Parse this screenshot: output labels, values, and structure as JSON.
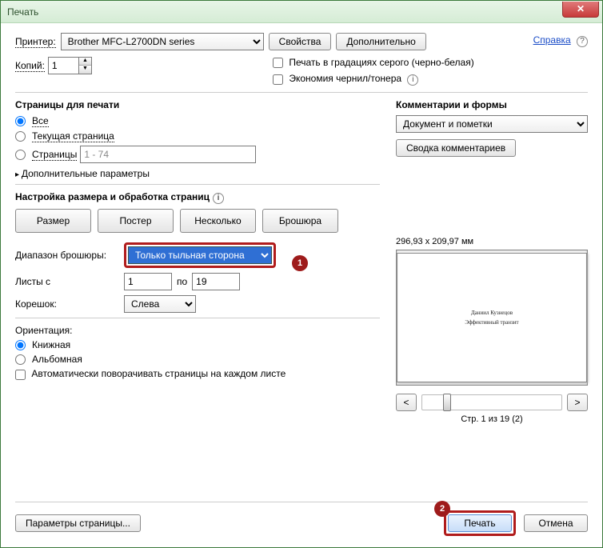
{
  "title": "Печать",
  "printer_label": "Принтер:",
  "printer_value": "Brother MFC-L2700DN series",
  "properties": "Свойства",
  "advanced": "Дополнительно",
  "help": "Справка",
  "copies_label": "Копий:",
  "copies_value": "1",
  "grayscale": "Печать в градациях серого (черно-белая)",
  "savetoner": "Экономия чернил/тонера",
  "pages_section": "Страницы для печати",
  "radio_all": "Все",
  "radio_current": "Текущая страница",
  "radio_pages": "Страницы",
  "pages_range": "1 - 74",
  "more_params": "Дополнительные параметры",
  "sizing_section": "Настройка размера и обработка страниц",
  "btn_size": "Размер",
  "btn_poster": "Постер",
  "btn_multi": "Несколько",
  "btn_booklet": "Брошюра",
  "booklet_range_label": "Диапазон брошюры:",
  "booklet_range_value": "Только тыльная сторона",
  "sheets_from_label": "Листы с",
  "sheets_from": "1",
  "sheets_to_label": "по",
  "sheets_to": "19",
  "binding_label": "Корешок:",
  "binding_value": "Слева",
  "orientation_label": "Ориентация:",
  "orient_portrait": "Книжная",
  "orient_landscape": "Альбомная",
  "auto_rotate": "Автоматически поворачивать страницы на каждом листе",
  "comments_section": "Комментарии и формы",
  "comments_value": "Документ и пометки",
  "summarize": "Сводка комментариев",
  "dimensions": "296,93 x 209,97 мм",
  "preview_line1": "Даниил Кузнецов",
  "preview_line2": "Эффективный транзит",
  "pageinfo": "Стр. 1 из 19 (2)",
  "pagesetup": "Параметры страницы...",
  "print": "Печать",
  "cancel": "Отмена",
  "callout1": "1",
  "callout2": "2"
}
